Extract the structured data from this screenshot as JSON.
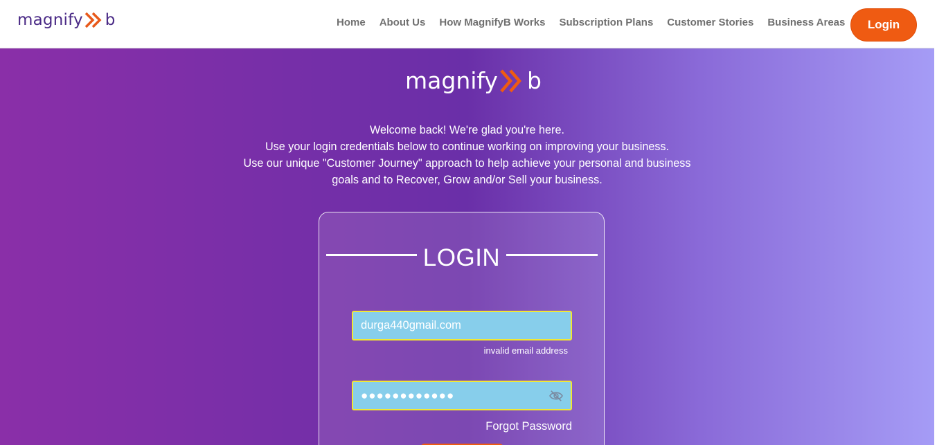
{
  "header": {
    "logo_text": "magnify",
    "logo_end": "b",
    "nav": [
      "Home",
      "About Us",
      "How MagnifyB Works",
      "Subscription Plans",
      "Customer Stories",
      "Business Areas"
    ],
    "login_label": "Login"
  },
  "hero": {
    "logo_text": "magnify",
    "logo_end": "b",
    "welcome_lines": [
      "Welcome back! We're glad you're here.",
      "Use your login credentials below to continue working on improving your business.",
      "Use our unique \"Customer Journey\" approach to help achieve your personal and business",
      "goals and to Recover, Grow and/or Sell your business."
    ]
  },
  "login_card": {
    "title": "LOGIN",
    "email_value": "durga440gmail.com",
    "email_error": "invalid email address",
    "password_value": "●●●●●●●●●●●●",
    "forgot_label": "Forgot Password"
  },
  "colors": {
    "brand_orange": "#ef5b12",
    "brand_purple": "#4a2a86",
    "field_bg": "#87ceeb",
    "field_border": "#f1e834"
  }
}
